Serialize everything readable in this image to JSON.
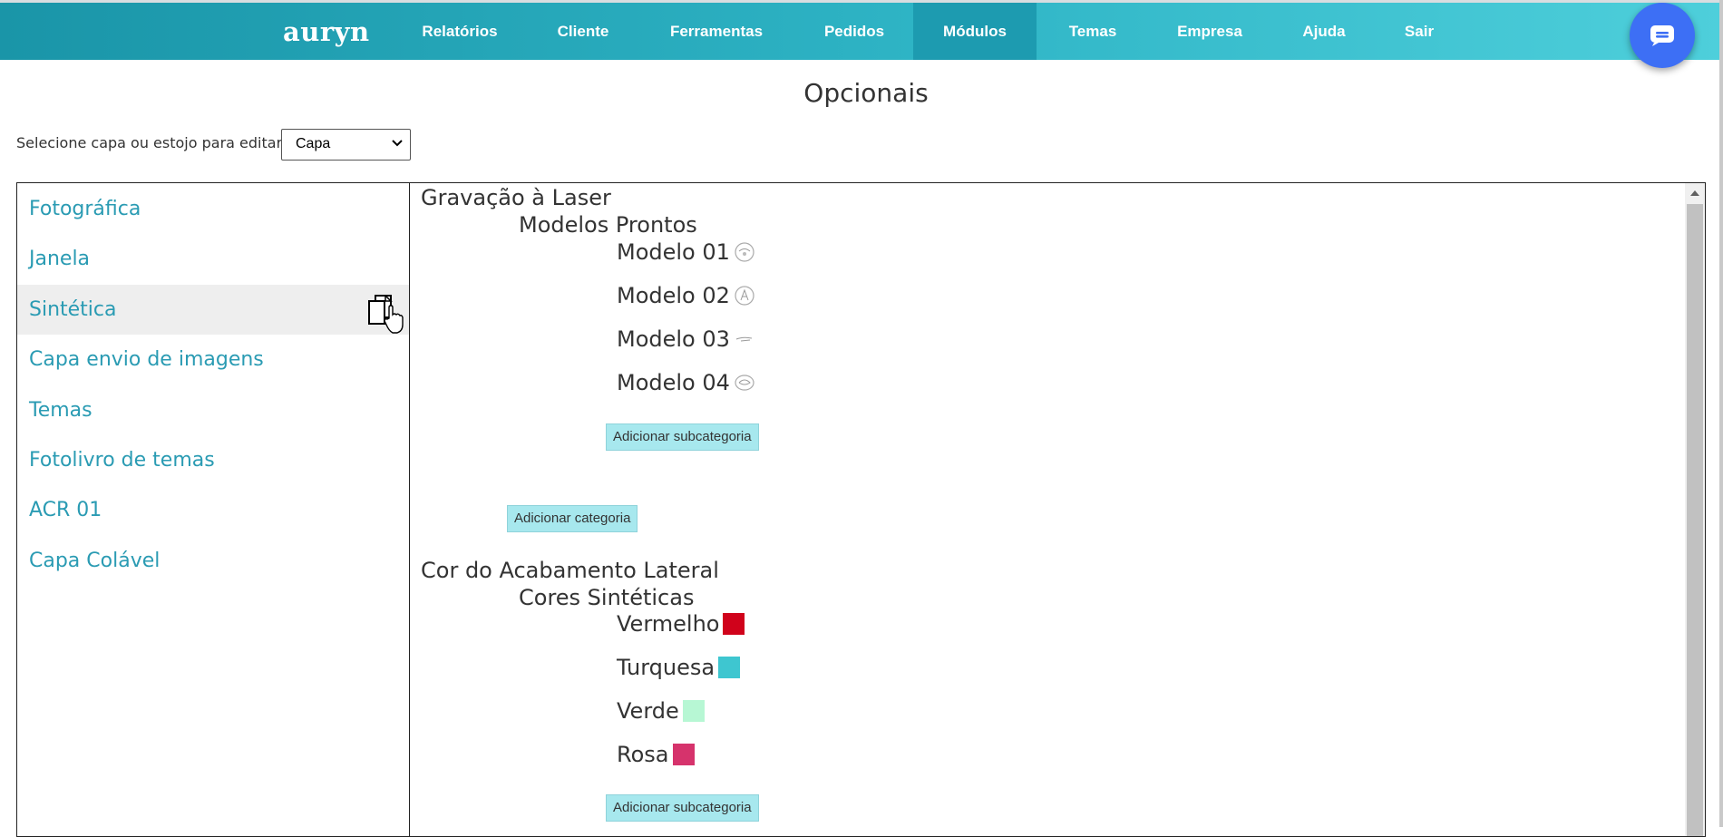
{
  "nav": {
    "brand": "auryn",
    "items": [
      {
        "label": "Relatórios"
      },
      {
        "label": "Cliente"
      },
      {
        "label": "Ferramentas"
      },
      {
        "label": "Pedidos"
      },
      {
        "label": "Módulos",
        "active": true
      },
      {
        "label": "Temas"
      },
      {
        "label": "Empresa"
      },
      {
        "label": "Ajuda"
      },
      {
        "label": "Sair"
      }
    ],
    "chat_icon": "chat-bubble-icon"
  },
  "page": {
    "title": "Opcionais",
    "select_label": "Selecione capa ou estojo para editar:",
    "select_value": "Capa"
  },
  "sidebar": {
    "items": [
      {
        "label": "Fotográfica"
      },
      {
        "label": "Janela"
      },
      {
        "label": "Sintética",
        "active": true
      },
      {
        "label": "Capa envio de imagens"
      },
      {
        "label": "Temas"
      },
      {
        "label": "Fotolivro de temas"
      },
      {
        "label": "ACR 01"
      },
      {
        "label": "Capa Colável"
      }
    ],
    "hover_icon": "copy-icon"
  },
  "content": {
    "categories": [
      {
        "name": "Gravação à Laser",
        "subcategory": "Modelos Prontos",
        "options": [
          "Modelo 01",
          "Modelo 02",
          "Modelo 03",
          "Modelo 04"
        ],
        "add_subcategory_label": "Adicionar subcategoria",
        "add_category_label": "Adicionar categoria"
      },
      {
        "name": "Cor do Acabamento Lateral",
        "subcategory": "Cores Sintéticas",
        "options": [
          {
            "label": "Vermelho",
            "color": "#d0021b"
          },
          {
            "label": "Turquesa",
            "color": "#3ec6d0"
          },
          {
            "label": "Verde",
            "color": "#b7f7d4"
          },
          {
            "label": "Rosa",
            "color": "#d6336c"
          }
        ],
        "add_subcategory_label": "Adicionar subcategoria"
      }
    ]
  }
}
